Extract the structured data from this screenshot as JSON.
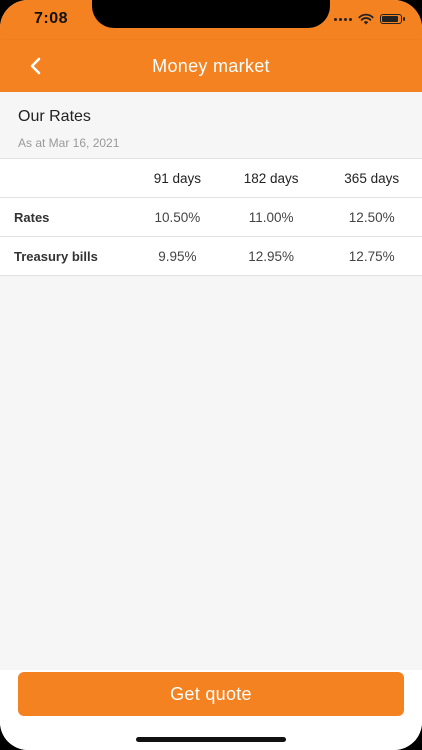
{
  "status_bar": {
    "time": "7:08"
  },
  "nav": {
    "title": "Money market",
    "back_icon": "chevron-left-icon"
  },
  "section": {
    "title": "Our Rates",
    "subtitle": "As at Mar 16, 2021"
  },
  "table": {
    "columns": [
      "91 days",
      "182 days",
      "365 days"
    ],
    "rows": [
      {
        "label": "Rates",
        "values": [
          "10.50%",
          "11.00%",
          "12.50%"
        ]
      },
      {
        "label": "Treasury bills",
        "values": [
          "9.95%",
          "12.95%",
          "12.75%"
        ]
      }
    ]
  },
  "footer": {
    "button_label": "Get quote"
  },
  "colors": {
    "accent": "#f58220",
    "background": "#f6f6f6"
  }
}
